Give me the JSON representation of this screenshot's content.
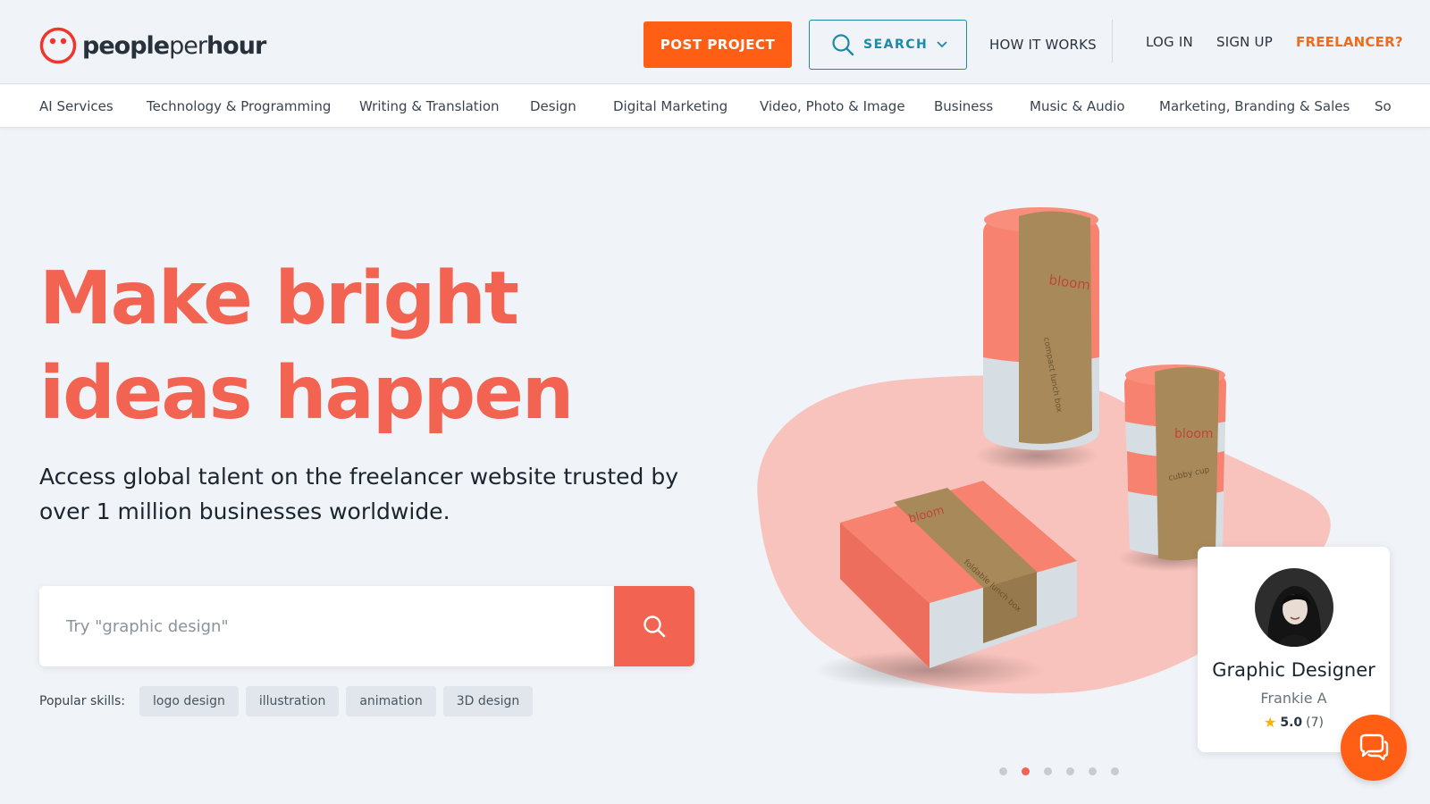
{
  "brand": {
    "name_part1": "people",
    "name_part2": "per",
    "name_part3": "hour",
    "accent_color": "#f26451",
    "cta_color": "#ff5e14"
  },
  "header": {
    "post_project": "POST PROJECT",
    "search": "SEARCH",
    "how_it_works": "HOW IT WORKS",
    "log_in": "LOG IN",
    "sign_up": "SIGN UP",
    "freelancer": "FREELANCER?"
  },
  "categories": [
    "AI Services",
    "Technology & Programming",
    "Writing & Translation",
    "Design",
    "Digital Marketing",
    "Video, Photo & Image",
    "Business",
    "Music & Audio",
    "Marketing, Branding & Sales",
    "So"
  ],
  "hero": {
    "title_line1": "Make bright",
    "title_line2": "ideas happen",
    "subtitle": "Access global talent on the freelancer website trusted by over 1 million businesses worldwide."
  },
  "search": {
    "placeholder": "Try \"graphic design\""
  },
  "popular": {
    "label": "Popular skills:",
    "skills": [
      "logo design",
      "illustration",
      "animation",
      "3D design"
    ]
  },
  "illustration": {
    "brand_text": "bloom",
    "product_1": "compact lunch box",
    "product_2": "cubby cup",
    "product_3": "foldable lunch box"
  },
  "freelancer_card": {
    "role": "Graphic Designer",
    "name": "Frankie A",
    "rating": "5.0",
    "reviews": "(7)"
  },
  "carousel": {
    "count": 6,
    "active_index": 1
  },
  "icons": {
    "logo": "smiley-logo-icon",
    "search": "search-icon",
    "chevron": "chevron-down-icon",
    "star": "star-icon",
    "chat": "chat-bubbles-icon"
  }
}
